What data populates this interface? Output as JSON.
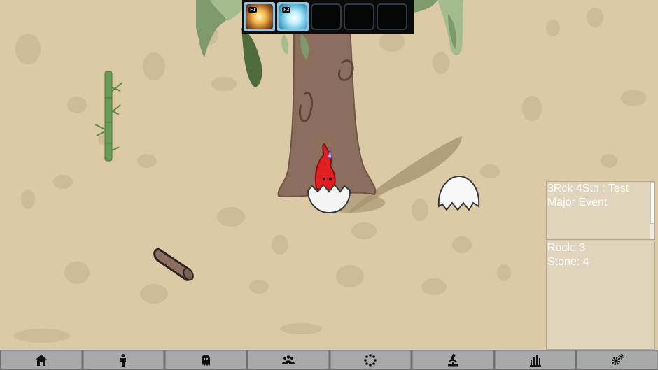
{
  "hotbar": {
    "slots": [
      {
        "key": "F1",
        "icon": "explosion-ability-icon",
        "filled": true
      },
      {
        "key": "F2",
        "icon": "ice-ability-icon",
        "filled": true
      },
      {
        "filled": false
      },
      {
        "filled": false
      },
      {
        "filled": false
      }
    ]
  },
  "event_panel": {
    "title": "3Rck 4Stn : Test",
    "subtitle": "Major Event"
  },
  "inventory_panel": {
    "line1": "Rock: 3",
    "line2": "Stone: 4"
  },
  "toolbar": {
    "buttons": [
      "home-icon",
      "person-icon",
      "ghost-icon",
      "group-icon",
      "loading-spinner-icon",
      "microscope-icon",
      "bar-chart-icon",
      "settings-gears-icon"
    ]
  },
  "colors": {
    "ground": "#dcc9a6",
    "creature_red": "#e02020",
    "toolbar_button": "#a8a8a8",
    "hotbar_bg": "#0b0b0b"
  }
}
